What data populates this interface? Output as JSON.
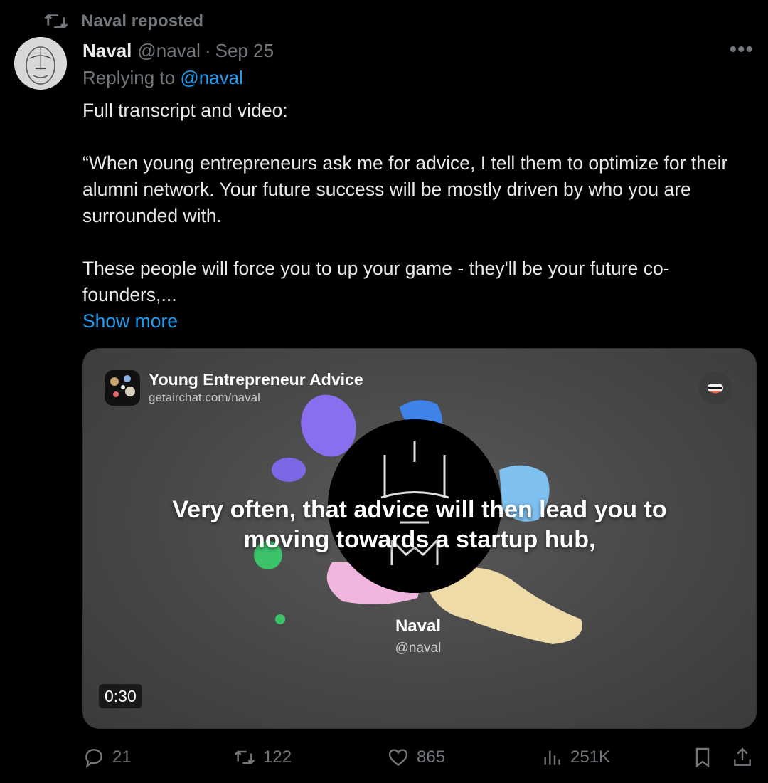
{
  "repost": {
    "text": "Naval reposted"
  },
  "tweet": {
    "author_name": "Naval",
    "author_handle": "@naval",
    "separator": "·",
    "date": "Sep 25",
    "more": "•••",
    "replying_prefix": "Replying to ",
    "replying_to": "@naval",
    "lines": {
      "intro": "Full transcript and video:",
      "quote1": "“When young entrepreneurs ask me for advice, I tell them to optimize for their alumni network. Your future success will be mostly driven by who you are surrounded with.",
      "quote2": "These people will force you to up your game - they'll be your future co-founders,..."
    },
    "show_more": "Show more"
  },
  "media": {
    "room_title": "Young Entrepreneur Advice",
    "room_url": "getairchat.com/naval",
    "caption_line1": "Very often, that advice will then lead you to",
    "caption_line2": "moving towards a startup hub,",
    "speaker_name": "Naval",
    "speaker_handle": "@naval",
    "duration": "0:30"
  },
  "actions": {
    "replies": "21",
    "reposts": "122",
    "likes": "865",
    "views": "251K"
  },
  "colors": {
    "background": "#000000",
    "text": "#e7e9ea",
    "muted": "#71767b",
    "link": "#1d9bf0"
  },
  "icons": [
    "repost-icon",
    "more-icon",
    "reply-icon",
    "repost-icon",
    "like-icon",
    "views-icon",
    "bookmark-icon",
    "share-icon"
  ]
}
